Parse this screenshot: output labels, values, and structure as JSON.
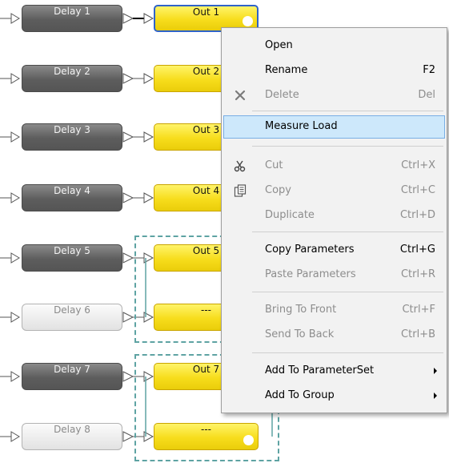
{
  "blocks": [
    {
      "delay": "Delay 1",
      "out": "Out 1"
    },
    {
      "delay": "Delay 2",
      "out": "Out 2"
    },
    {
      "delay": "Delay 3",
      "out": "Out 3"
    },
    {
      "delay": "Delay 4",
      "out": "Out 4"
    },
    {
      "delay": "Delay 5",
      "out": "Out 5"
    },
    {
      "delay": "Delay 6",
      "out": "---"
    },
    {
      "delay": "Delay 7",
      "out": "Out 7"
    },
    {
      "delay": "Delay 8",
      "out": "---"
    }
  ],
  "context_menu": {
    "items": [
      {
        "label": "Open",
        "shortcut": "",
        "enabled": true
      },
      {
        "label": "Rename",
        "shortcut": "F2",
        "enabled": true
      },
      {
        "label": "Delete",
        "shortcut": "Del",
        "enabled": false,
        "icon": "close-icon"
      },
      {
        "label": "Measure Load",
        "shortcut": "",
        "enabled": true,
        "highlighted": true
      },
      {
        "label": "Cut",
        "shortcut": "Ctrl+X",
        "enabled": false,
        "icon": "scissors-icon"
      },
      {
        "label": "Copy",
        "shortcut": "Ctrl+C",
        "enabled": false,
        "icon": "copy-icon"
      },
      {
        "label": "Duplicate",
        "shortcut": "Ctrl+D",
        "enabled": false
      },
      {
        "label": "Copy Parameters",
        "shortcut": "Ctrl+G",
        "enabled": true
      },
      {
        "label": "Paste Parameters",
        "shortcut": "Ctrl+R",
        "enabled": false
      },
      {
        "label": "Bring To Front",
        "shortcut": "Ctrl+F",
        "enabled": false
      },
      {
        "label": "Send To Back",
        "shortcut": "Ctrl+B",
        "enabled": false
      },
      {
        "label": "Add To ParameterSet",
        "shortcut": "",
        "enabled": true,
        "submenu": true
      },
      {
        "label": "Add To Group",
        "shortcut": "",
        "enabled": true,
        "submenu": true
      }
    ]
  },
  "colors": {
    "delay_fill": "#666666",
    "delay_disabled_fill": "#eeeeee",
    "out_fill": "#f7dd1c",
    "selection_border": "#2f63c9",
    "group_border": "#5ea3a3",
    "menu_highlight": "#cde8fb"
  }
}
